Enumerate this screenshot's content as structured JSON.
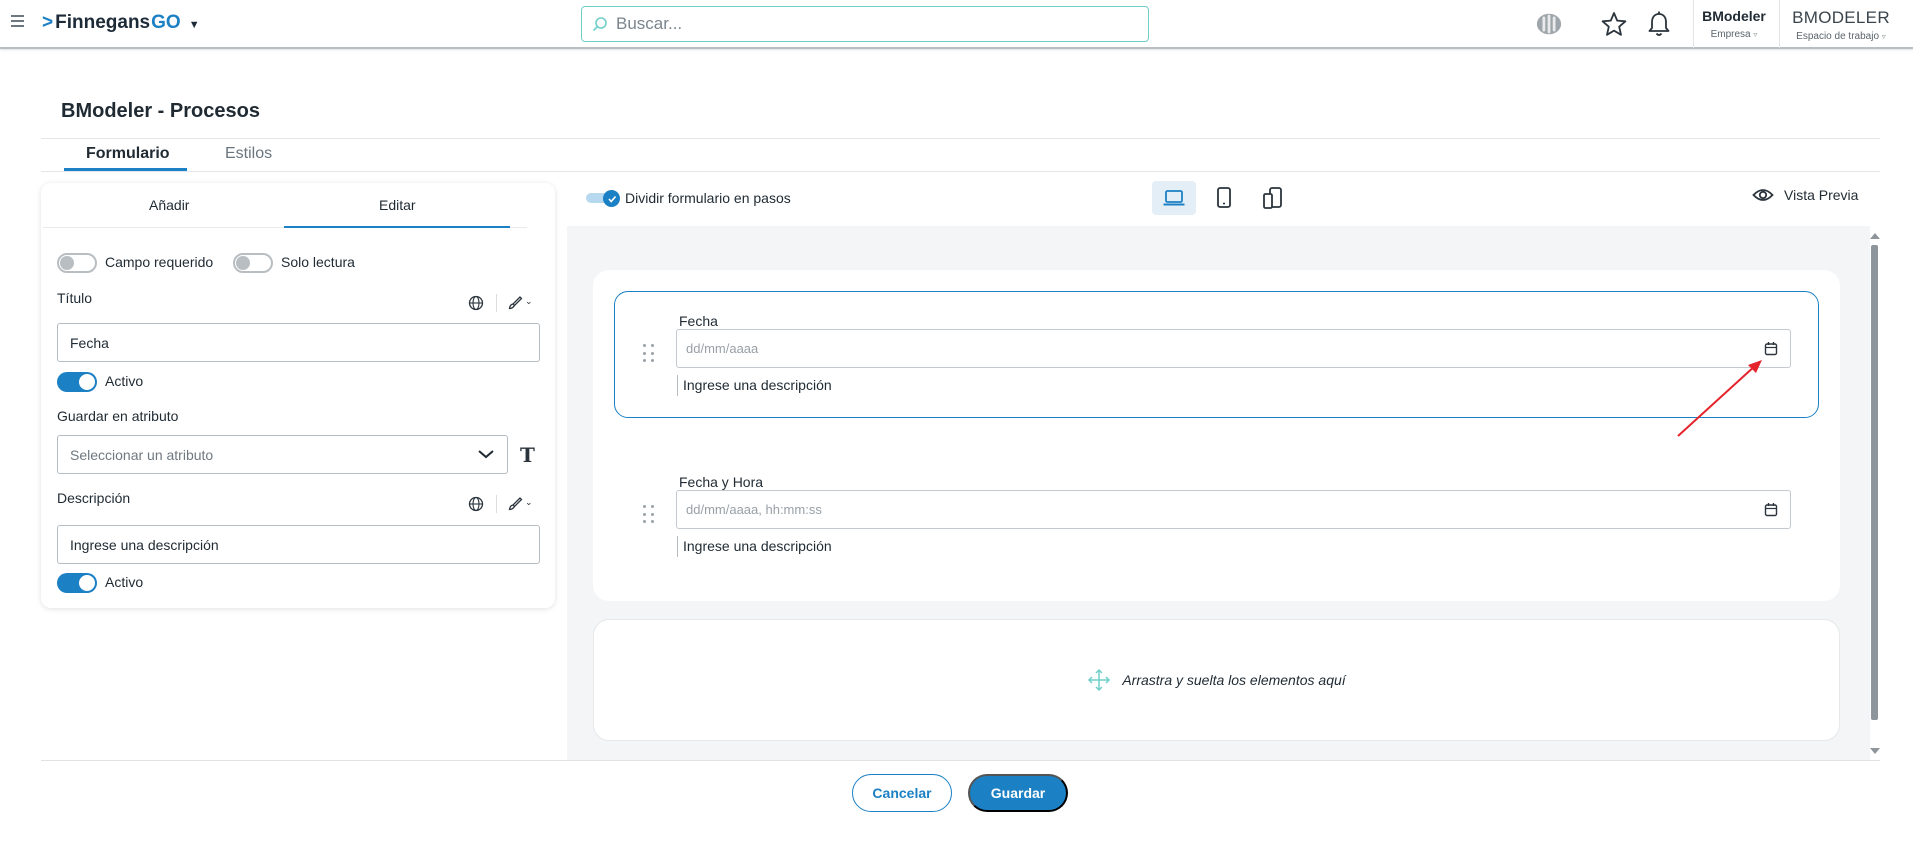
{
  "header": {
    "brand_main": "Finnegans",
    "brand_go": "GO",
    "search_placeholder": "Buscar...",
    "company_name": "BModeler",
    "company_label": "Empresa",
    "workspace_name": "BMODELER",
    "workspace_label": "Espacio de trabajo"
  },
  "page": {
    "title": "BModeler - Procesos",
    "tabs": [
      {
        "label": "Formulario",
        "active": true
      },
      {
        "label": "Estilos",
        "active": false
      }
    ]
  },
  "panel": {
    "tabs": [
      {
        "label": "Añadir",
        "active": false
      },
      {
        "label": "Editar",
        "active": true
      }
    ],
    "required_label": "Campo requerido",
    "required_on": false,
    "readonly_label": "Solo lectura",
    "readonly_on": false,
    "title_label": "Título",
    "title_value": "Fecha",
    "title_active_label": "Activo",
    "title_active_on": true,
    "save_attr_label": "Guardar en atributo",
    "save_attr_placeholder": "Seleccionar un atributo",
    "description_label": "Descripción",
    "description_value": "Ingrese una descripción",
    "description_active_label": "Activo",
    "description_active_on": true
  },
  "form_area": {
    "split_steps_label": "Dividir formulario en pasos",
    "split_steps_on": true,
    "preview_label": "Vista Previa",
    "fields": [
      {
        "label": "Fecha",
        "placeholder": "dd/mm/aaaa",
        "description": "Ingrese una descripción",
        "selected": true
      },
      {
        "label": "Fecha y Hora",
        "placeholder": "dd/mm/aaaa, hh:mm:ss",
        "description": "Ingrese una descripción",
        "selected": false
      }
    ],
    "drop_zone_text": "Arrastra y suelta los elementos aquí"
  },
  "footer": {
    "cancel_label": "Cancelar",
    "save_label": "Guardar"
  },
  "colors": {
    "accent": "#1c80c4",
    "search_border": "#6fcfc9",
    "annotation_arrow": "#e4232b"
  },
  "icons": {
    "menu": "hamburger-icon",
    "search": "search-icon",
    "gemini": "assistant-icon",
    "favorite": "star-icon",
    "notifications": "bell-icon",
    "translate": "globe-icon",
    "style": "brush-icon",
    "text_type": "text-icon",
    "calendar": "calendar-icon",
    "drag": "drag-handle-icon",
    "move": "move-icon",
    "preview": "eye-icon",
    "laptop": "laptop-icon",
    "tablet": "tablet-icon",
    "mobile": "mobile-icon"
  }
}
